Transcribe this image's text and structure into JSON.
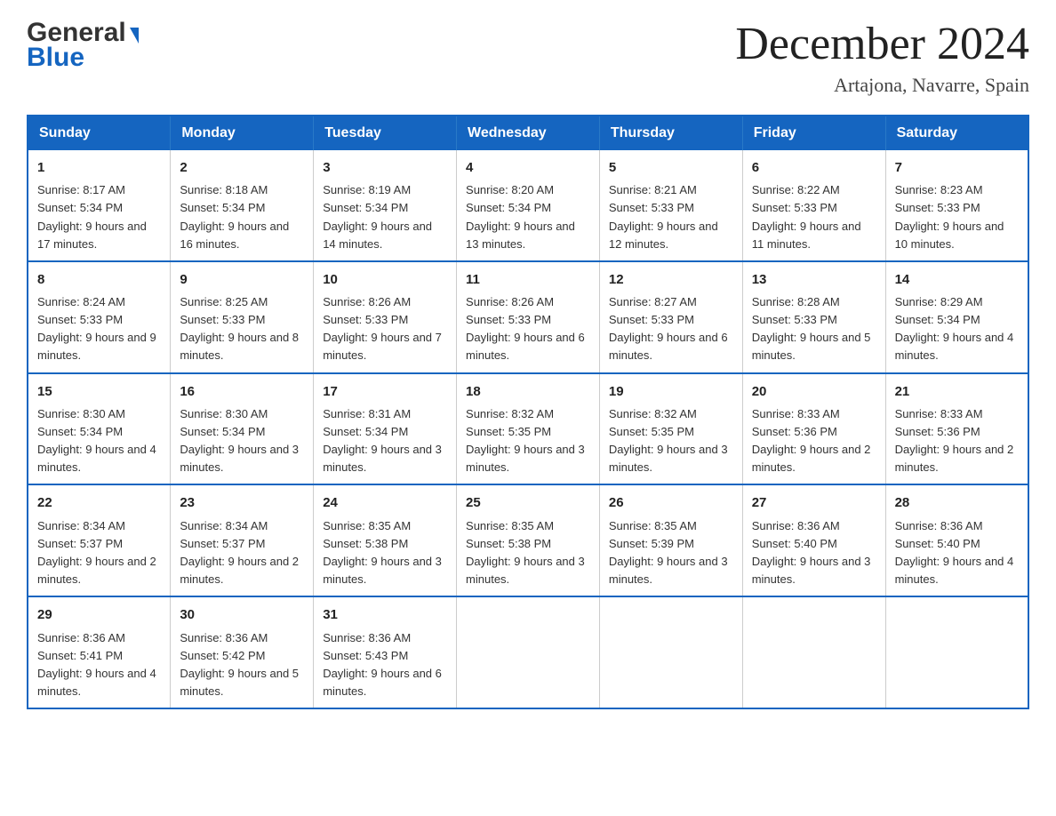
{
  "header": {
    "logo_general": "General",
    "logo_blue": "Blue",
    "month_title": "December 2024",
    "location": "Artajona, Navarre, Spain"
  },
  "days_of_week": [
    "Sunday",
    "Monday",
    "Tuesday",
    "Wednesday",
    "Thursday",
    "Friday",
    "Saturday"
  ],
  "weeks": [
    [
      {
        "day": "1",
        "sunrise": "Sunrise: 8:17 AM",
        "sunset": "Sunset: 5:34 PM",
        "daylight": "Daylight: 9 hours and 17 minutes."
      },
      {
        "day": "2",
        "sunrise": "Sunrise: 8:18 AM",
        "sunset": "Sunset: 5:34 PM",
        "daylight": "Daylight: 9 hours and 16 minutes."
      },
      {
        "day": "3",
        "sunrise": "Sunrise: 8:19 AM",
        "sunset": "Sunset: 5:34 PM",
        "daylight": "Daylight: 9 hours and 14 minutes."
      },
      {
        "day": "4",
        "sunrise": "Sunrise: 8:20 AM",
        "sunset": "Sunset: 5:34 PM",
        "daylight": "Daylight: 9 hours and 13 minutes."
      },
      {
        "day": "5",
        "sunrise": "Sunrise: 8:21 AM",
        "sunset": "Sunset: 5:33 PM",
        "daylight": "Daylight: 9 hours and 12 minutes."
      },
      {
        "day": "6",
        "sunrise": "Sunrise: 8:22 AM",
        "sunset": "Sunset: 5:33 PM",
        "daylight": "Daylight: 9 hours and 11 minutes."
      },
      {
        "day": "7",
        "sunrise": "Sunrise: 8:23 AM",
        "sunset": "Sunset: 5:33 PM",
        "daylight": "Daylight: 9 hours and 10 minutes."
      }
    ],
    [
      {
        "day": "8",
        "sunrise": "Sunrise: 8:24 AM",
        "sunset": "Sunset: 5:33 PM",
        "daylight": "Daylight: 9 hours and 9 minutes."
      },
      {
        "day": "9",
        "sunrise": "Sunrise: 8:25 AM",
        "sunset": "Sunset: 5:33 PM",
        "daylight": "Daylight: 9 hours and 8 minutes."
      },
      {
        "day": "10",
        "sunrise": "Sunrise: 8:26 AM",
        "sunset": "Sunset: 5:33 PM",
        "daylight": "Daylight: 9 hours and 7 minutes."
      },
      {
        "day": "11",
        "sunrise": "Sunrise: 8:26 AM",
        "sunset": "Sunset: 5:33 PM",
        "daylight": "Daylight: 9 hours and 6 minutes."
      },
      {
        "day": "12",
        "sunrise": "Sunrise: 8:27 AM",
        "sunset": "Sunset: 5:33 PM",
        "daylight": "Daylight: 9 hours and 6 minutes."
      },
      {
        "day": "13",
        "sunrise": "Sunrise: 8:28 AM",
        "sunset": "Sunset: 5:33 PM",
        "daylight": "Daylight: 9 hours and 5 minutes."
      },
      {
        "day": "14",
        "sunrise": "Sunrise: 8:29 AM",
        "sunset": "Sunset: 5:34 PM",
        "daylight": "Daylight: 9 hours and 4 minutes."
      }
    ],
    [
      {
        "day": "15",
        "sunrise": "Sunrise: 8:30 AM",
        "sunset": "Sunset: 5:34 PM",
        "daylight": "Daylight: 9 hours and 4 minutes."
      },
      {
        "day": "16",
        "sunrise": "Sunrise: 8:30 AM",
        "sunset": "Sunset: 5:34 PM",
        "daylight": "Daylight: 9 hours and 3 minutes."
      },
      {
        "day": "17",
        "sunrise": "Sunrise: 8:31 AM",
        "sunset": "Sunset: 5:34 PM",
        "daylight": "Daylight: 9 hours and 3 minutes."
      },
      {
        "day": "18",
        "sunrise": "Sunrise: 8:32 AM",
        "sunset": "Sunset: 5:35 PM",
        "daylight": "Daylight: 9 hours and 3 minutes."
      },
      {
        "day": "19",
        "sunrise": "Sunrise: 8:32 AM",
        "sunset": "Sunset: 5:35 PM",
        "daylight": "Daylight: 9 hours and 3 minutes."
      },
      {
        "day": "20",
        "sunrise": "Sunrise: 8:33 AM",
        "sunset": "Sunset: 5:36 PM",
        "daylight": "Daylight: 9 hours and 2 minutes."
      },
      {
        "day": "21",
        "sunrise": "Sunrise: 8:33 AM",
        "sunset": "Sunset: 5:36 PM",
        "daylight": "Daylight: 9 hours and 2 minutes."
      }
    ],
    [
      {
        "day": "22",
        "sunrise": "Sunrise: 8:34 AM",
        "sunset": "Sunset: 5:37 PM",
        "daylight": "Daylight: 9 hours and 2 minutes."
      },
      {
        "day": "23",
        "sunrise": "Sunrise: 8:34 AM",
        "sunset": "Sunset: 5:37 PM",
        "daylight": "Daylight: 9 hours and 2 minutes."
      },
      {
        "day": "24",
        "sunrise": "Sunrise: 8:35 AM",
        "sunset": "Sunset: 5:38 PM",
        "daylight": "Daylight: 9 hours and 3 minutes."
      },
      {
        "day": "25",
        "sunrise": "Sunrise: 8:35 AM",
        "sunset": "Sunset: 5:38 PM",
        "daylight": "Daylight: 9 hours and 3 minutes."
      },
      {
        "day": "26",
        "sunrise": "Sunrise: 8:35 AM",
        "sunset": "Sunset: 5:39 PM",
        "daylight": "Daylight: 9 hours and 3 minutes."
      },
      {
        "day": "27",
        "sunrise": "Sunrise: 8:36 AM",
        "sunset": "Sunset: 5:40 PM",
        "daylight": "Daylight: 9 hours and 3 minutes."
      },
      {
        "day": "28",
        "sunrise": "Sunrise: 8:36 AM",
        "sunset": "Sunset: 5:40 PM",
        "daylight": "Daylight: 9 hours and 4 minutes."
      }
    ],
    [
      {
        "day": "29",
        "sunrise": "Sunrise: 8:36 AM",
        "sunset": "Sunset: 5:41 PM",
        "daylight": "Daylight: 9 hours and 4 minutes."
      },
      {
        "day": "30",
        "sunrise": "Sunrise: 8:36 AM",
        "sunset": "Sunset: 5:42 PM",
        "daylight": "Daylight: 9 hours and 5 minutes."
      },
      {
        "day": "31",
        "sunrise": "Sunrise: 8:36 AM",
        "sunset": "Sunset: 5:43 PM",
        "daylight": "Daylight: 9 hours and 6 minutes."
      },
      {
        "day": "",
        "sunrise": "",
        "sunset": "",
        "daylight": ""
      },
      {
        "day": "",
        "sunrise": "",
        "sunset": "",
        "daylight": ""
      },
      {
        "day": "",
        "sunrise": "",
        "sunset": "",
        "daylight": ""
      },
      {
        "day": "",
        "sunrise": "",
        "sunset": "",
        "daylight": ""
      }
    ]
  ]
}
